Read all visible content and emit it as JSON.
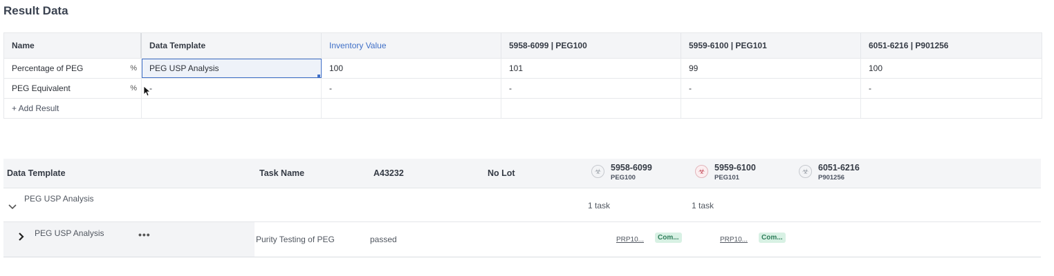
{
  "page": {
    "title": "Result Data"
  },
  "result_grid": {
    "headers": [
      "Name",
      "Data Template",
      "Inventory Value",
      "5958-6099 | PEG100",
      "5959-6100 | PEG101",
      "6051-6216 | P901256"
    ],
    "rows": [
      {
        "name": "Percentage of PEG",
        "unit": "%",
        "template": "PEG USP Analysis",
        "values": [
          "100",
          "101",
          "99",
          "100"
        ]
      },
      {
        "name": "PEG Equivalent",
        "unit": "%",
        "template": "-",
        "values": [
          "-",
          "-",
          "-",
          "-"
        ]
      }
    ],
    "add_result": "+ Add Result"
  },
  "lower_table": {
    "headers": {
      "data_template": "Data Template",
      "task_name": "Task Name",
      "a_id": "A43232",
      "no_lot": "No Lot"
    },
    "samples": [
      {
        "id": "5958-6099",
        "sub": "PEG100"
      },
      {
        "id": "5959-6100",
        "sub": "PEG101"
      },
      {
        "id": "6051-6216",
        "sub": "P901256"
      }
    ],
    "group": {
      "name": "PEG USP Analysis",
      "counts": [
        "1 task",
        "1 task"
      ]
    },
    "item": {
      "name": "PEG USP Analysis",
      "menu": "•••",
      "task": "Purity Testing of PEG",
      "status": "passed",
      "links": [
        "PRP10...",
        "PRP10..."
      ],
      "badges": [
        "Com...",
        "Com..."
      ]
    }
  },
  "icons": {
    "chevron_down": "⌄",
    "chevron_right": "›",
    "biohazard": "☣"
  }
}
